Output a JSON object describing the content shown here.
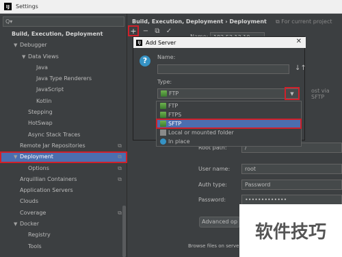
{
  "window": {
    "title": "Settings",
    "app_icon": "IJ"
  },
  "sidebar": {
    "search_placeholder": "Q▾",
    "items": [
      {
        "label": "Build, Execution, Deployment",
        "indent": 0,
        "arrow": "",
        "bold": true
      },
      {
        "label": "Debugger",
        "indent": 1,
        "arrow": "▼"
      },
      {
        "label": "Data Views",
        "indent": 2,
        "arrow": "▼"
      },
      {
        "label": "Java",
        "indent": 3,
        "arrow": ""
      },
      {
        "label": "Java Type Renderers",
        "indent": 3,
        "arrow": ""
      },
      {
        "label": "JavaScript",
        "indent": 3,
        "arrow": ""
      },
      {
        "label": "Kotlin",
        "indent": 3,
        "arrow": ""
      },
      {
        "label": "Stepping",
        "indent": 2,
        "arrow": ""
      },
      {
        "label": "HotSwap",
        "indent": 2,
        "arrow": ""
      },
      {
        "label": "Async Stack Traces",
        "indent": 2,
        "arrow": ""
      },
      {
        "label": "Remote Jar Repositories",
        "indent": 1,
        "arrow": "",
        "copy": true
      },
      {
        "label": "Deployment",
        "indent": 1,
        "arrow": "▼",
        "selected": true,
        "copy": true
      },
      {
        "label": "Options",
        "indent": 2,
        "arrow": "",
        "copy": true
      },
      {
        "label": "Arquillian Containers",
        "indent": 1,
        "arrow": "",
        "copy": true
      },
      {
        "label": "Application Servers",
        "indent": 1,
        "arrow": ""
      },
      {
        "label": "Clouds",
        "indent": 1,
        "arrow": ""
      },
      {
        "label": "Coverage",
        "indent": 1,
        "arrow": "",
        "copy": true
      },
      {
        "label": "Docker",
        "indent": 1,
        "arrow": "▼"
      },
      {
        "label": "Registry",
        "indent": 2,
        "arrow": ""
      },
      {
        "label": "Tools",
        "indent": 2,
        "arrow": ""
      }
    ]
  },
  "main": {
    "breadcrumb_parent": "Build, Execution, Deployment",
    "breadcrumb_sep": "›",
    "breadcrumb_current": "Deployment",
    "for_current_project": "For current project",
    "name_label": "Name:",
    "name_value": "192.53.13.10",
    "root_path_label": "Root path:",
    "root_path_value": "/",
    "user_name_label": "User name:",
    "user_name_value": "root",
    "auth_type_label": "Auth type:",
    "auth_type_value": "Password",
    "password_label": "Password:",
    "password_value": "•••••••••••••",
    "advanced_button": "Advanced op",
    "browse_text": "Browse files on serve",
    "partial_right_text": "ost via SFTP"
  },
  "dialog": {
    "title": "Add Server",
    "name_label": "Name:",
    "type_label": "Type:",
    "type_value": "FTP",
    "options": [
      {
        "label": "FTP",
        "icon": "ftp-icon"
      },
      {
        "label": "FTPS",
        "icon": "ftps-icon"
      },
      {
        "label": "SFTP",
        "icon": "sftp-icon",
        "selected": true
      },
      {
        "label": "Local or mounted folder",
        "icon": "local-folder-icon"
      },
      {
        "label": "In place",
        "icon": "in-place-icon"
      }
    ]
  },
  "watermark": {
    "text": "软件技巧"
  },
  "colors": {
    "selection": "#4b6eaf",
    "highlight_border": "#d0202a",
    "background": "#3c3f41"
  }
}
